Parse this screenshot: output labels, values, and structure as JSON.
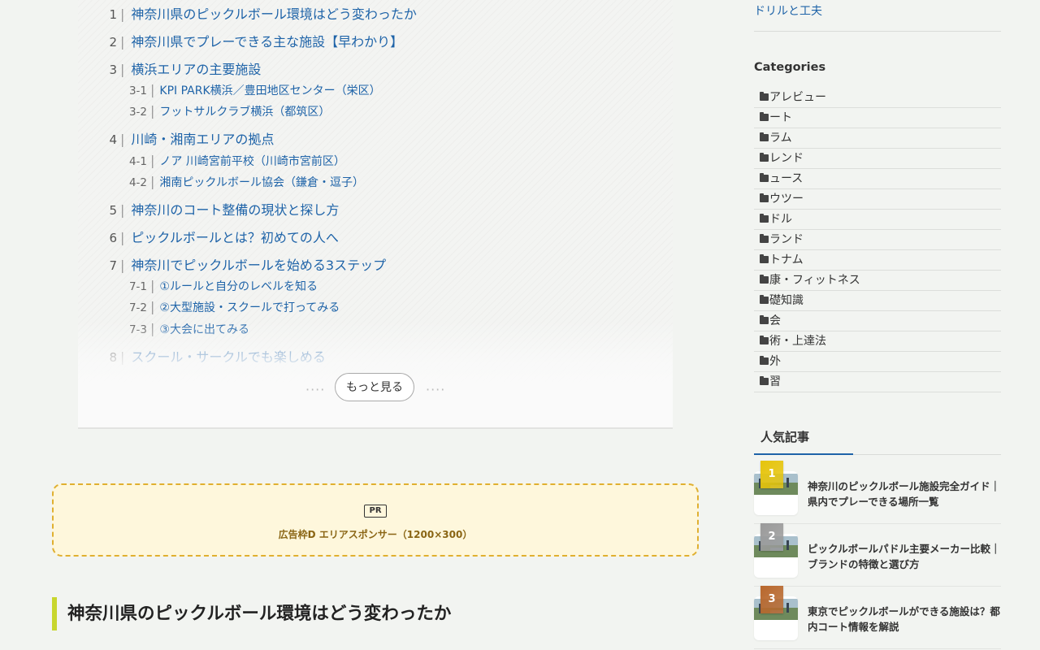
{
  "toc": {
    "items": [
      {
        "level": 2,
        "num": "1",
        "text": "神奈川県のピックルボール環境はどう変わったか"
      },
      {
        "level": 2,
        "num": "2",
        "text": "神奈川県でプレーできる主な施設【早わかり】"
      },
      {
        "level": 2,
        "num": "3",
        "text": "横浜エリアの主要施設"
      },
      {
        "level": 3,
        "num": "3-1",
        "text": "KPI PARK横浜／豊田地区センター（栄区）"
      },
      {
        "level": 3,
        "num": "3-2",
        "text": "フットサルクラブ横浜（都筑区）"
      },
      {
        "level": 2,
        "num": "4",
        "text": "川崎・湘南エリアの拠点"
      },
      {
        "level": 3,
        "num": "4-1",
        "text": "ノア 川崎宮前平校（川崎市宮前区）"
      },
      {
        "level": 3,
        "num": "4-2",
        "text": "湘南ピックルボール協会（鎌倉・逗子）"
      },
      {
        "level": 2,
        "num": "5",
        "text": "神奈川のコート整備の現状と探し方"
      },
      {
        "level": 2,
        "num": "6",
        "text": "ピックルボールとは？初めての人へ"
      },
      {
        "level": 2,
        "num": "7",
        "text": "神奈川でピックルボールを始める3ステップ"
      },
      {
        "level": 3,
        "num": "7-1",
        "text": "①ルールと自分のレベルを知る"
      },
      {
        "level": 3,
        "num": "7-2",
        "text": "②大型施設・スクールで打ってみる"
      },
      {
        "level": 3,
        "num": "7-3",
        "text": "③大会に出てみる"
      },
      {
        "level": 2,
        "num": "8",
        "text": "スクール・サークルでも楽しめる"
      }
    ],
    "more_label": "もっと見る",
    "separator": "|"
  },
  "ad": {
    "badge": "PR",
    "text": "広告枠D エリアスポンサー（1200×300）"
  },
  "article": {
    "heading": "神奈川県のピックルボール環境はどう変わったか"
  },
  "sidebar": {
    "top_link": "ドリルと工夫",
    "categories_title": "Categories",
    "categories": [
      "アレビュー",
      "ート",
      "ラム",
      "レンド",
      "ュース",
      "ウツー",
      "ドル",
      "ランド",
      "トナム",
      "康・フィットネス",
      "礎知識",
      "会",
      "術・上達法",
      "外",
      "習"
    ],
    "popular_title": "人気記事",
    "popular": [
      {
        "rank": "1",
        "title": "神奈川のピックルボール施設完全ガイド｜県内でプレーできる場所一覧",
        "badge_color": "#e6c40a"
      },
      {
        "rank": "2",
        "title": "ピックルボールパドル主要メーカー比較｜ブランドの特徴と選び方",
        "badge_color": "#9a9a9a"
      },
      {
        "rank": "3",
        "title": "東京でピックルボールができる施設は？都内コート情報を解説",
        "badge_color": "#b8672c"
      }
    ]
  }
}
